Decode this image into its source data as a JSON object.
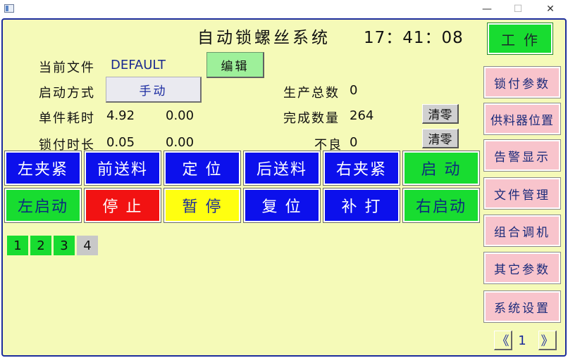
{
  "window": {
    "minimize_glyph": "—",
    "maximize_glyph": "☐",
    "close_glyph": "✕"
  },
  "header": {
    "title": "自动锁螺丝系统",
    "clock": "17：41：08",
    "work_button": "工作"
  },
  "info": {
    "current_file_label": "当前文件",
    "current_file_value": "DEFAULT",
    "edit_button": "编辑",
    "start_mode_label": "启动方式",
    "start_mode_value": "手动",
    "unit_time_label": "单件耗时",
    "unit_time_value1": "4.92",
    "unit_time_value2": "0.00",
    "lock_time_label": "锁付时长",
    "lock_time_value1": "0.05",
    "lock_time_value2": "0.00",
    "total_label": "生产总数",
    "total_value": "0",
    "done_label": "完成数量",
    "done_value": "264",
    "clear_button_1": "清零",
    "defect_label": "不良",
    "defect_value": "0",
    "clear_button_2": "清零"
  },
  "actions_row1": [
    {
      "label": "左夹紧",
      "color": "blue"
    },
    {
      "label": "前送料",
      "color": "blue"
    },
    {
      "label": "定 位",
      "color": "blue"
    },
    {
      "label": "后送料",
      "color": "blue"
    },
    {
      "label": "右夹紧",
      "color": "blue"
    },
    {
      "label": "启 动",
      "color": "green"
    }
  ],
  "actions_row2": [
    {
      "label": "左启动",
      "color": "green"
    },
    {
      "label": "停 止",
      "color": "red"
    },
    {
      "label": "暂 停",
      "color": "yellow"
    },
    {
      "label": "复 位",
      "color": "blue"
    },
    {
      "label": "补 打",
      "color": "blue"
    },
    {
      "label": "右启动",
      "color": "green"
    }
  ],
  "stations": [
    "1",
    "2",
    "3",
    "4"
  ],
  "sidebar": {
    "items": [
      "锁付参数",
      "供料器位置",
      "告警显示",
      "文件管理",
      "组合调机",
      "其它参数",
      "系统设置"
    ]
  },
  "pager": {
    "prev": "《",
    "page": "1",
    "next": "》"
  },
  "colors": {
    "background": "#f5fab8",
    "frame_border": "#1c2c9c",
    "blue_button": "#0c10ec",
    "green_button": "#18dc30",
    "red_button": "#f21212",
    "yellow_button": "#ffff10",
    "side_button": "#f8c4cc"
  }
}
